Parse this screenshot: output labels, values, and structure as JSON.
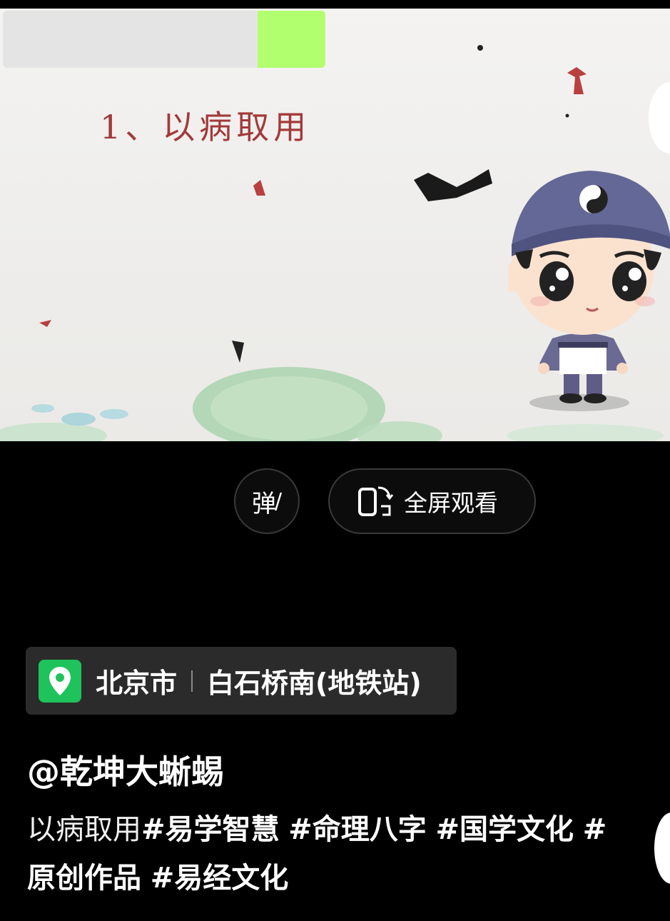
{
  "video": {
    "title": "1、以病取用",
    "progress": 0.21
  },
  "controls": {
    "danmaku_label": "弹",
    "fullscreen_label": "全屏观看"
  },
  "location": {
    "city": "北京市",
    "place": "白石桥南(地铁站)",
    "pin_color": "#1ec35b"
  },
  "post": {
    "author": "@乾坤大蜥蜴",
    "caption_text": "以病取用",
    "tags": [
      "#易学智慧",
      "#命理八字",
      "#国学文化",
      "#原创作品",
      "#易经文化"
    ]
  },
  "colors": {
    "progress_fill": "#b1ff6f",
    "title_red": "#a23a3a"
  }
}
